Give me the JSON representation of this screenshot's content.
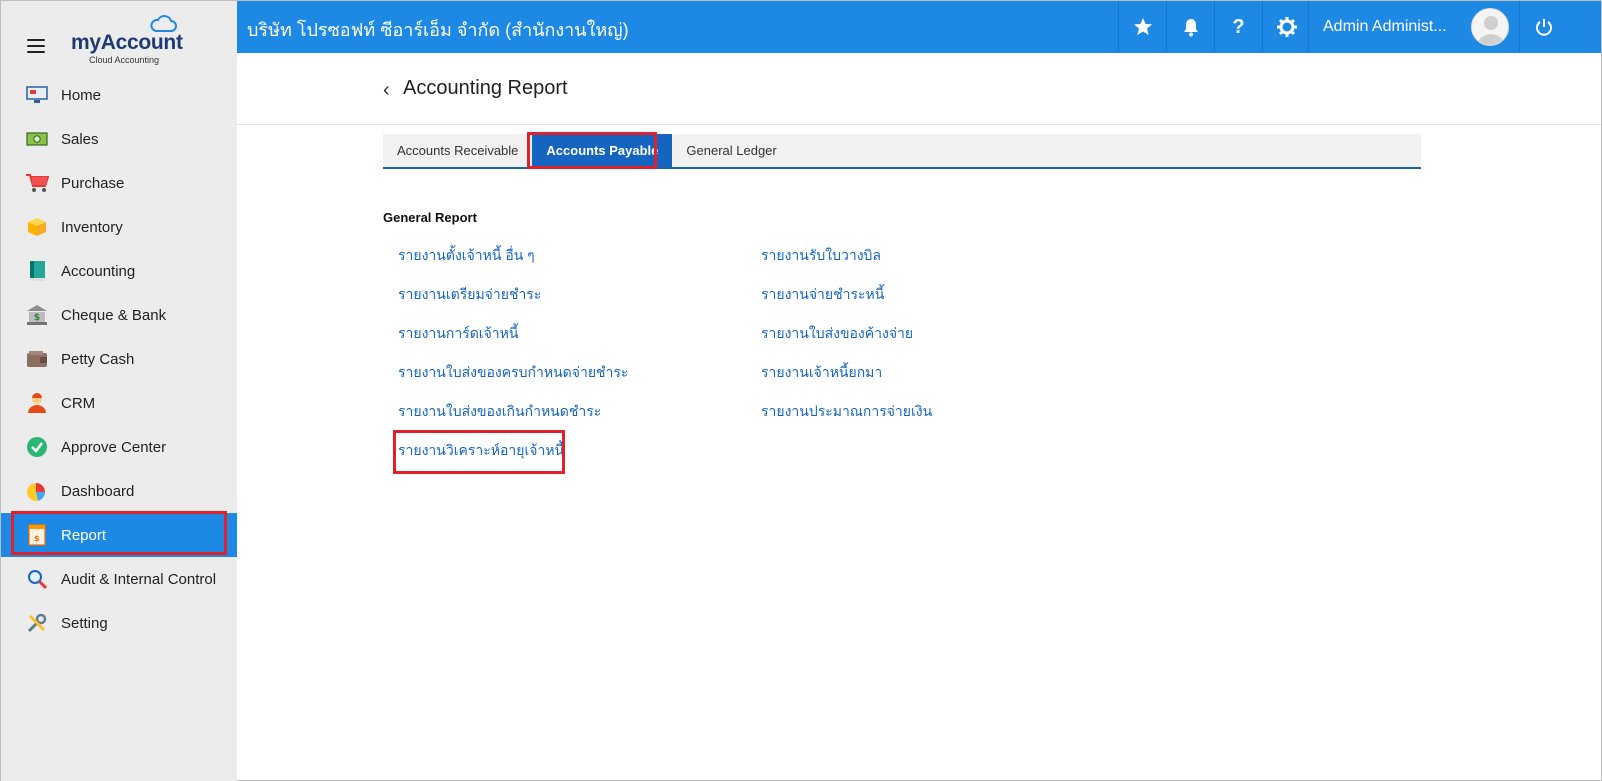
{
  "app": {
    "logo_text": "myAccount",
    "logo_sub": "Cloud Accounting",
    "company": "บริษัท โปรซอฟท์ ซีอาร์เอ็ม จำกัด (สำนักงานใหญ่)",
    "user_name": "Admin Administ..."
  },
  "colors": {
    "primary": "#1e88e5",
    "tab_active": "#1565c0",
    "highlight": "#e0202a",
    "link": "#1565c0"
  },
  "sidebar": {
    "items": [
      {
        "label": "Home",
        "icon": "home-monitor-icon"
      },
      {
        "label": "Sales",
        "icon": "money-icon"
      },
      {
        "label": "Purchase",
        "icon": "cart-icon"
      },
      {
        "label": "Inventory",
        "icon": "box-icon"
      },
      {
        "label": "Accounting",
        "icon": "book-icon"
      },
      {
        "label": "Cheque & Bank",
        "icon": "bank-icon"
      },
      {
        "label": "Petty Cash",
        "icon": "wallet-icon"
      },
      {
        "label": "CRM",
        "icon": "person-icon"
      },
      {
        "label": "Approve Center",
        "icon": "check-circle-icon"
      },
      {
        "label": "Dashboard",
        "icon": "pie-chart-icon"
      },
      {
        "label": "Report",
        "icon": "report-icon",
        "active": true
      },
      {
        "label": "Audit & Internal Control",
        "icon": "magnifier-icon"
      },
      {
        "label": "Setting",
        "icon": "tools-icon"
      }
    ]
  },
  "page": {
    "title": "Accounting Report",
    "tabs": [
      "Accounts Receivable",
      "Accounts Payable",
      "General Ledger"
    ],
    "active_tab": "Accounts Payable",
    "section_title": "General Report",
    "links_left": [
      "รายงานตั้งเจ้าหนี้ อื่น ๆ",
      "รายงานเตรียมจ่ายชำระ",
      "รายงานการ์ดเจ้าหนี้",
      "รายงานใบส่งของครบกำหนดจ่ายชำระ",
      "รายงานใบส่งของเกินกำหนดชำระ",
      "รายงานวิเคราะห์อายุเจ้าหนี้"
    ],
    "links_right": [
      "รายงานรับใบวางบิล",
      "รายงานจ่ายชำระหนี้",
      "รายงานใบส่งของค้างจ่าย",
      "รายงานเจ้าหนี้ยกมา",
      "รายงานประมาณการจ่ายเงิน"
    ]
  }
}
